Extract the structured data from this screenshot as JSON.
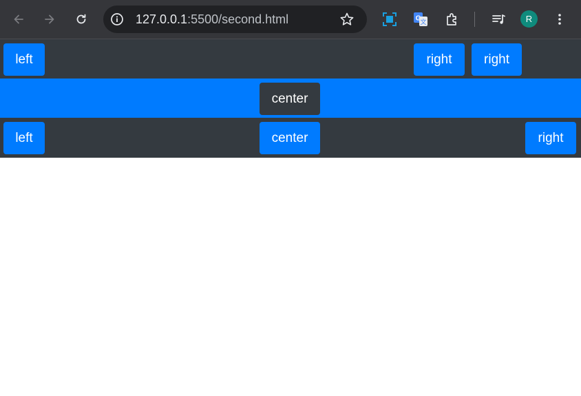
{
  "browser": {
    "url_host": "127.0.0.1",
    "url_path": ":5500/second.html",
    "profile_initial": "R",
    "icons": [
      "back-arrow-icon",
      "forward-arrow-icon",
      "reload-icon",
      "site-info-icon",
      "bookmark-star-icon",
      "screen-capture-icon",
      "google-translate-icon",
      "extensions-puzzle-icon",
      "media-queue-icon",
      "more-vert-icon"
    ]
  },
  "rows": [
    {
      "buttons": [
        {
          "label": "left"
        },
        {
          "label": "right"
        },
        {
          "label": "right"
        }
      ]
    },
    {
      "buttons": [
        {
          "label": "center"
        }
      ]
    },
    {
      "buttons": [
        {
          "label": "left"
        },
        {
          "label": "center"
        },
        {
          "label": "right"
        }
      ]
    }
  ],
  "colors": {
    "primary": "#007bff",
    "dark": "#343a40",
    "toolbar": "#35363a",
    "omnibox": "#202124",
    "avatar": "#0f8b7d"
  }
}
